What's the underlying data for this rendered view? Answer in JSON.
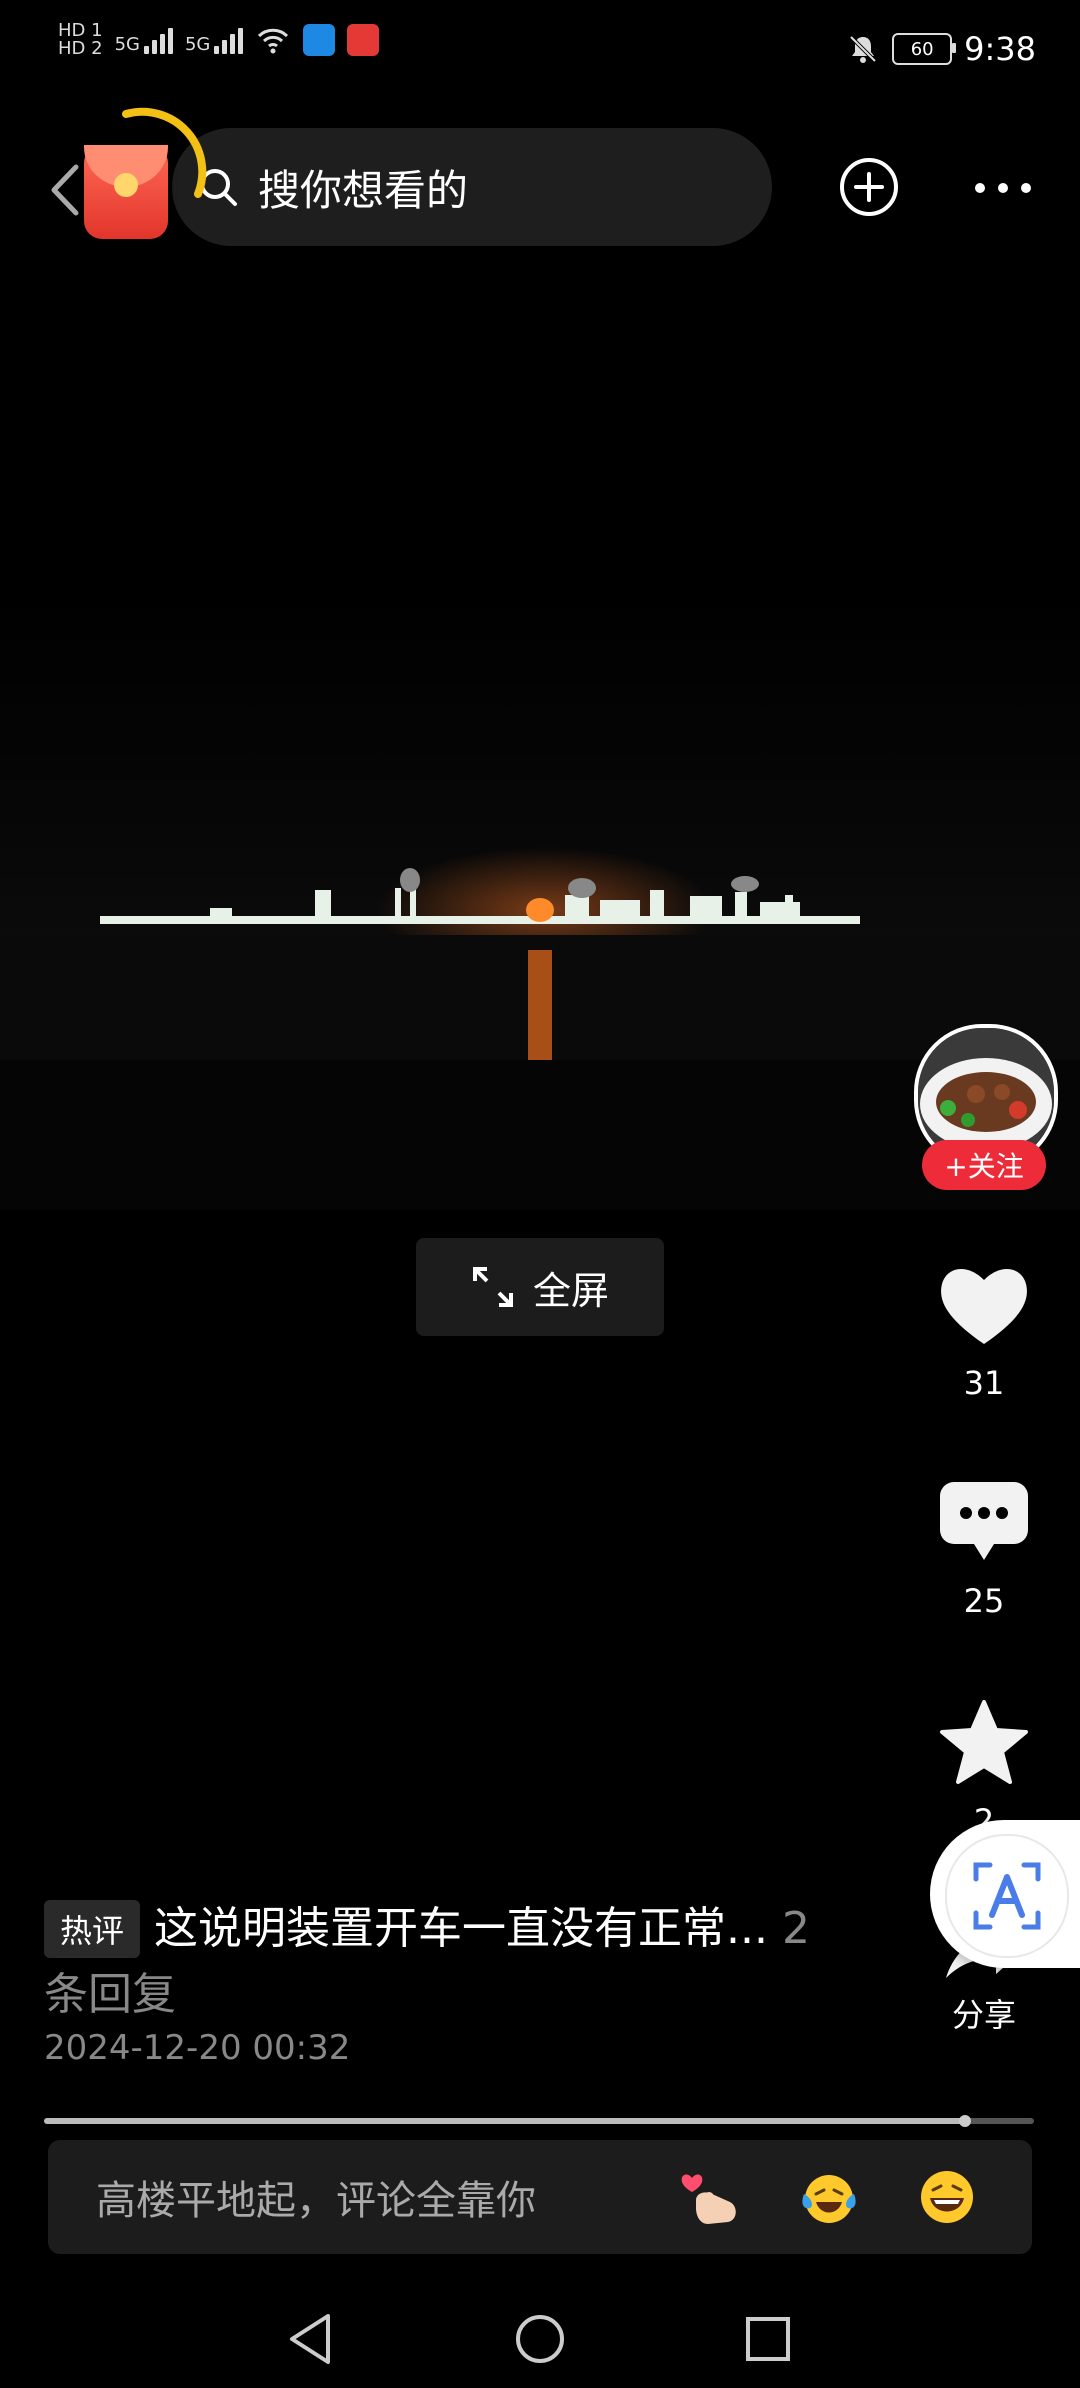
{
  "status_bar": {
    "hd1": "HD 1",
    "hd2": "HD 2",
    "net1": "5G",
    "net2": "5G",
    "battery": "60",
    "time": "9:38"
  },
  "top_bar": {
    "search_placeholder": "搜你想看的",
    "icons": [
      "back-arrow-icon",
      "red-packet-icon",
      "search-icon",
      "plus-circle-icon",
      "more-dots-icon"
    ]
  },
  "player": {
    "fullscreen_label": "全屏"
  },
  "right_rail": {
    "follow_label": "+关注",
    "like_count": "31",
    "comment_count": "25",
    "favorite_count": "2",
    "share_label": "分享"
  },
  "caption": {
    "hot_tag": "热评",
    "comment": "这说明装置开车一直没有正常...",
    "reply_count": "2",
    "reply_suffix": "条回复",
    "date": "2024-12-20 00:32"
  },
  "progress": {
    "fraction": 0.93
  },
  "comment_box": {
    "placeholder": "高楼平地起，评论全靠你",
    "emojis": [
      "finger-heart",
      "laughing-tears",
      "grinning"
    ]
  }
}
